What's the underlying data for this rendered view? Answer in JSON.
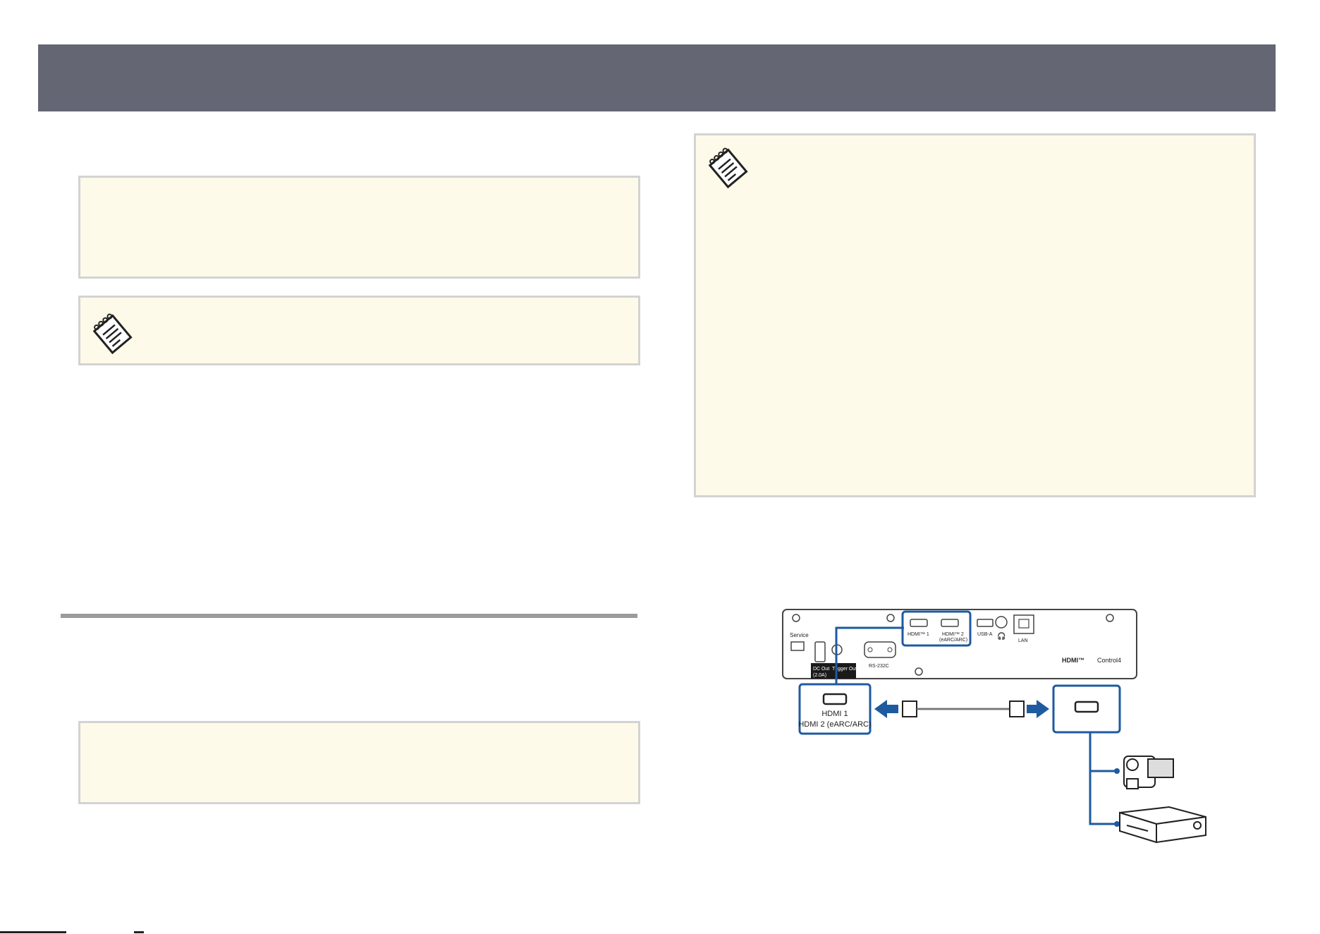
{
  "colors": {
    "header": "#646674",
    "note_bg": "#fdfae9",
    "note_border": "#d3d3d3",
    "rule": "#9b9b9b",
    "highlight": "#1e5aa0"
  },
  "icons": {
    "note": "note-pad-icon"
  },
  "diagram": {
    "service_label": "Service",
    "dc_out_label": "DC Out",
    "dc_out_amp": "(2.0A)",
    "trigger_out_label": "Trigger Out",
    "rs232c_label": "RS-232C",
    "hdmi1_port_label": "HDMI™ 1",
    "hdmi2_port_label": "HDMI™ 2",
    "hdmi2_port_sub": "(eARC/ARC)",
    "usba_label": "USB-A",
    "lan_label": "LAN",
    "hdmi_logo": "HDMI™",
    "control_logo": "Control4",
    "callout_line1": "HDMI 1",
    "callout_line2": "HDMI 2 (eARC/ARC)"
  }
}
